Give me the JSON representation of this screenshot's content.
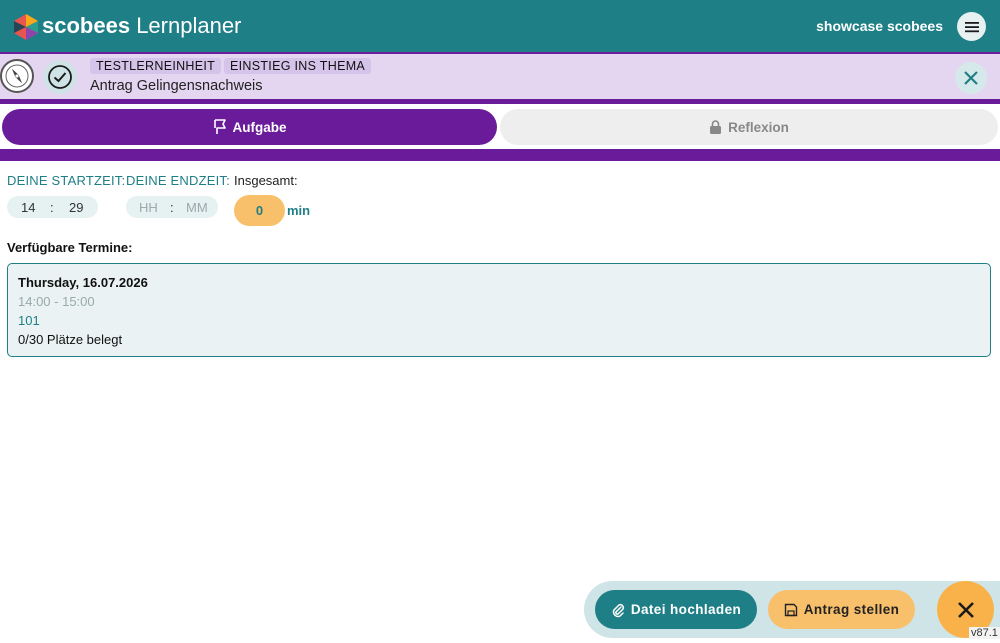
{
  "header": {
    "brand_bold": "scobees",
    "brand_light": "Lernplaner",
    "user_name": "showcase scobees",
    "logo_icon": "scobees-logo-icon",
    "menu_icon": "hamburger-menu-icon"
  },
  "context": {
    "crumbs": [
      "TESTLERNEINHEIT",
      "EINSTIEG INS THEMA"
    ],
    "title": "Antrag Gelingensnachweis",
    "compass_icon": "compass-icon",
    "check_icon": "check-circle-icon",
    "close_icon": "close-icon"
  },
  "tabs": [
    {
      "label": "Aufgabe",
      "icon": "flag-icon",
      "active": true
    },
    {
      "label": "Reflexion",
      "icon": "lock-icon",
      "active": false
    }
  ],
  "time": {
    "start_label": "DEINE STARTZEIT:",
    "end_label": "DEINE ENDZEIT:",
    "total_label": "Insgesamt:",
    "start_hh": "14",
    "start_mm": "29",
    "end_hh_placeholder": "HH",
    "end_mm_placeholder": "MM",
    "separator": ":",
    "total_value": "0",
    "total_unit": "min"
  },
  "termine": {
    "label": "Verfügbare Termine:",
    "items": [
      {
        "date": "Thursday, 16.07.2026",
        "time": "14:00 - 15:00",
        "room": "101",
        "seats": "0/30 Plätze belegt"
      }
    ]
  },
  "actions": {
    "upload_label": "Datei hochladen",
    "upload_icon": "paperclip-icon",
    "submit_label": "Antrag stellen",
    "submit_icon": "save-icon",
    "close_icon": "close-icon"
  },
  "version": "v87.1",
  "colors": {
    "teal": "#1f7f86",
    "purple": "#6a1b9a",
    "lavender": "#e4d5f0",
    "amber": "#f9c06b"
  }
}
